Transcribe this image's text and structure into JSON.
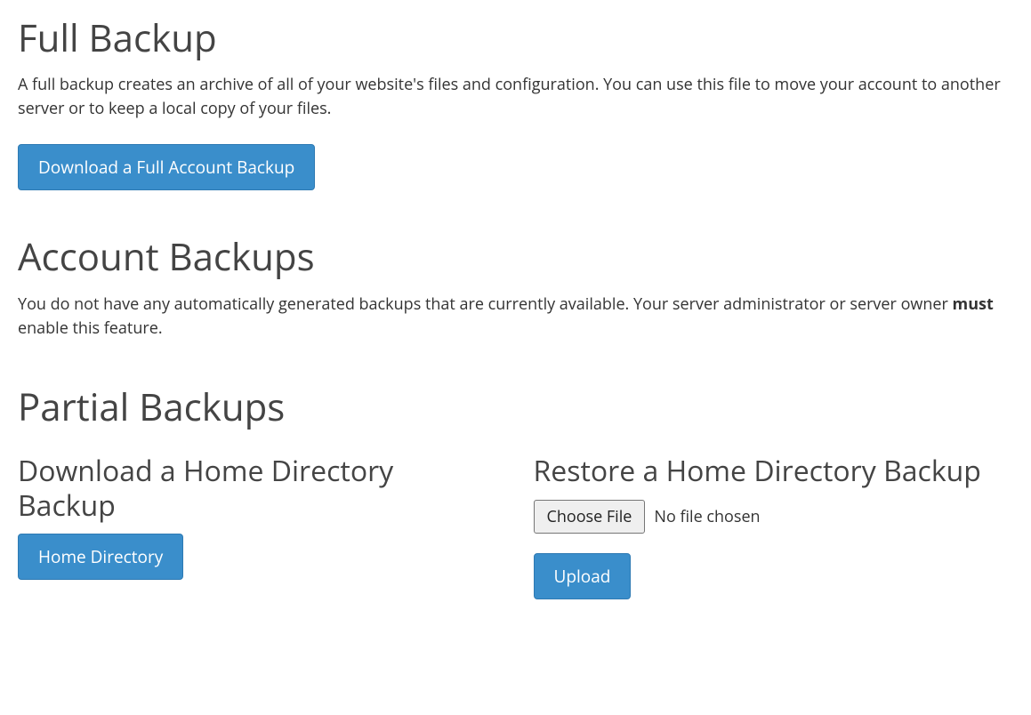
{
  "full_backup": {
    "title": "Full Backup",
    "description": "A full backup creates an archive of all of your website's files and configuration. You can use this file to move your account to another server or to keep a local copy of your files.",
    "button_label": "Download a Full Account Backup"
  },
  "account_backups": {
    "title": "Account Backups",
    "desc_pre": "You do not have any automatically generated backups that are currently available. Your server administrator or server owner ",
    "desc_bold": "must",
    "desc_post": " enable this feature."
  },
  "partial_backups": {
    "title": "Partial Backups",
    "download": {
      "title": "Download a Home Directory Backup",
      "button_label": "Home Directory"
    },
    "restore": {
      "title": "Restore a Home Directory Backup",
      "choose_file_label": "Choose File",
      "no_file_text": "No file chosen",
      "upload_label": "Upload"
    }
  }
}
